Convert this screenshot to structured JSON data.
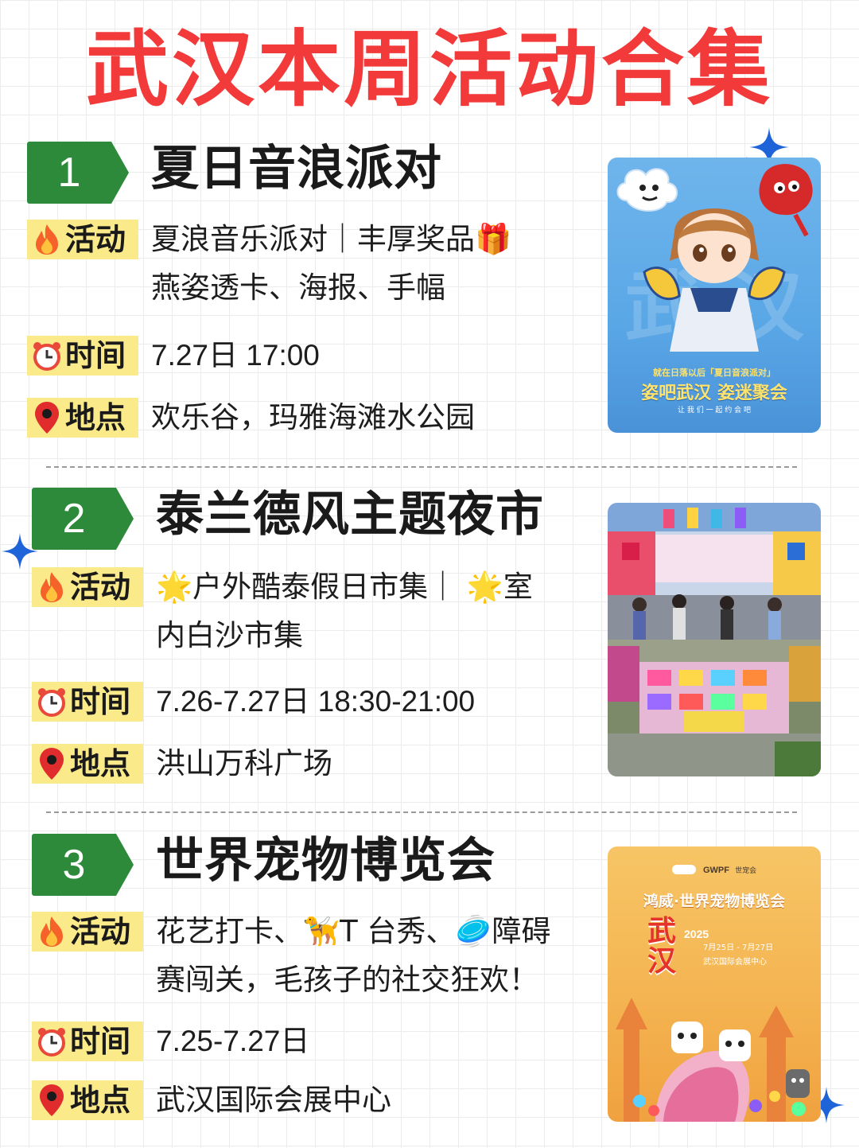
{
  "page": {
    "title": "武汉本周活动合集"
  },
  "events": [
    {
      "number": "1",
      "title": "夏日音浪派对",
      "activity_label": "活动",
      "activity_line1": "夏浪音乐派对｜丰厚奖品🎁",
      "activity_line2": "燕姿透卡、海报、手幅",
      "time_label": "时间",
      "time": "7.27日 17:00",
      "place_label": "地点",
      "place": "欢乐谷，玛雅海滩水公园",
      "poster": {
        "watermark": "武 汉",
        "line1": "就在日落以后「夏日音浪派对」",
        "line2": "姿吧武汉 姿迷聚会",
        "line3": "让 我 们 一 起 约 会 吧"
      }
    },
    {
      "number": "2",
      "title": "泰兰德风主题夜市",
      "activity_label": "活动",
      "activity_line1": "🌟户外酷泰假日市集｜ 🌟室",
      "activity_line2": "内白沙市集",
      "time_label": "时间",
      "time": "7.26-7.27日 18:30-21:00",
      "place_label": "地点",
      "place": "洪山万科广场"
    },
    {
      "number": "3",
      "title": "世界宠物博览会",
      "activity_label": "活动",
      "activity_line1": "花艺打卡、🦮T 台秀、🥏障碍",
      "activity_line2": "赛闯关，毛孩子的社交狂欢！",
      "time_label": "时间",
      "time": "7.25-7.27日",
      "place_label": "地点",
      "place": "武汉国际会展中心",
      "poster": {
        "logo": "GWPF",
        "logo_sub": "世宠会",
        "line1": "鸿威·世界宠物博览会",
        "badge": "武汉",
        "year": "2025",
        "dates": "7月25日 - 7月27日",
        "venue": "武汉国际会展中心"
      }
    }
  ],
  "colors": {
    "title_red": "#f23a3a",
    "badge_green": "#2c8a3a",
    "tag_yellow": "#fbea8a",
    "sparkle_blue": "#1f63d8"
  },
  "icons": [
    "fire-icon",
    "alarm-clock-icon",
    "location-pin-icon",
    "sparkle-icon"
  ]
}
